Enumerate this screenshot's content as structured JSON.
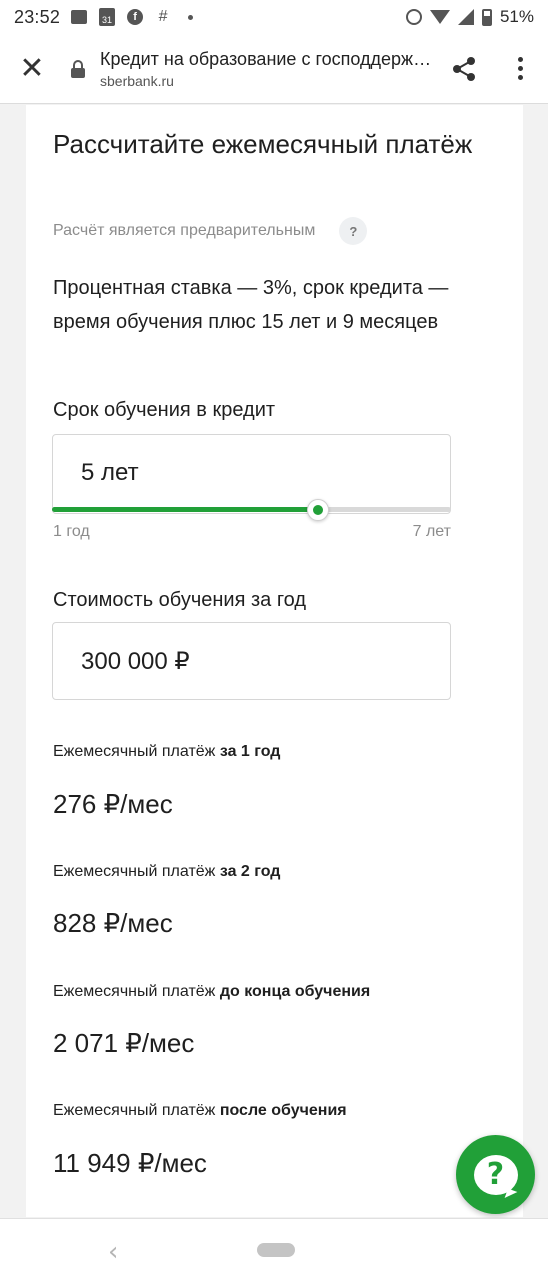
{
  "status_bar": {
    "time": "23:52",
    "calendar_day": "31",
    "battery": "51%",
    "icons": [
      "image-icon",
      "calendar-icon",
      "facebook-icon",
      "slack-icon",
      "dot-icon",
      "alarm-icon",
      "wifi-icon",
      "signal-icon",
      "battery-icon"
    ]
  },
  "toolbar": {
    "close_label": "✕",
    "title": "Кредит на образование с господдержкой",
    "url": "sberbank.ru"
  },
  "calculator": {
    "title": "Рассчитайте ежемесячный платёж",
    "subtitle": "Расчёт является предварительным",
    "help_badge": "?",
    "description": "Процентная ставка — 3%, срок кредита — время обучения плюс 15 лет и 9 месяцев",
    "term": {
      "label": "Срок обучения в кредит",
      "value": "5 лет",
      "min_label": "1 год",
      "max_label": "7 лет",
      "min": 1,
      "max": 7,
      "current": 5
    },
    "cost": {
      "label": "Стоимость обучения за год",
      "value": "300 000 ₽"
    },
    "payments": [
      {
        "label_prefix": "Ежемесячный платёж",
        "label_bold": "за 1 год",
        "value": "276 ₽/мес"
      },
      {
        "label_prefix": "Ежемесячный платёж",
        "label_bold": "за 2 год",
        "value": "828 ₽/мес"
      },
      {
        "label_prefix": "Ежемесячный платёж",
        "label_bold": "до конца обучения",
        "value": "2 071 ₽/мес"
      },
      {
        "label_prefix": "Ежемесячный платёж",
        "label_bold": "после обучения",
        "value": "11 949 ₽/мес"
      }
    ]
  },
  "fab": {
    "label": "?"
  },
  "colors": {
    "accent": "#21a038",
    "muted": "#8c8c8c",
    "text": "#1f1f1f"
  }
}
